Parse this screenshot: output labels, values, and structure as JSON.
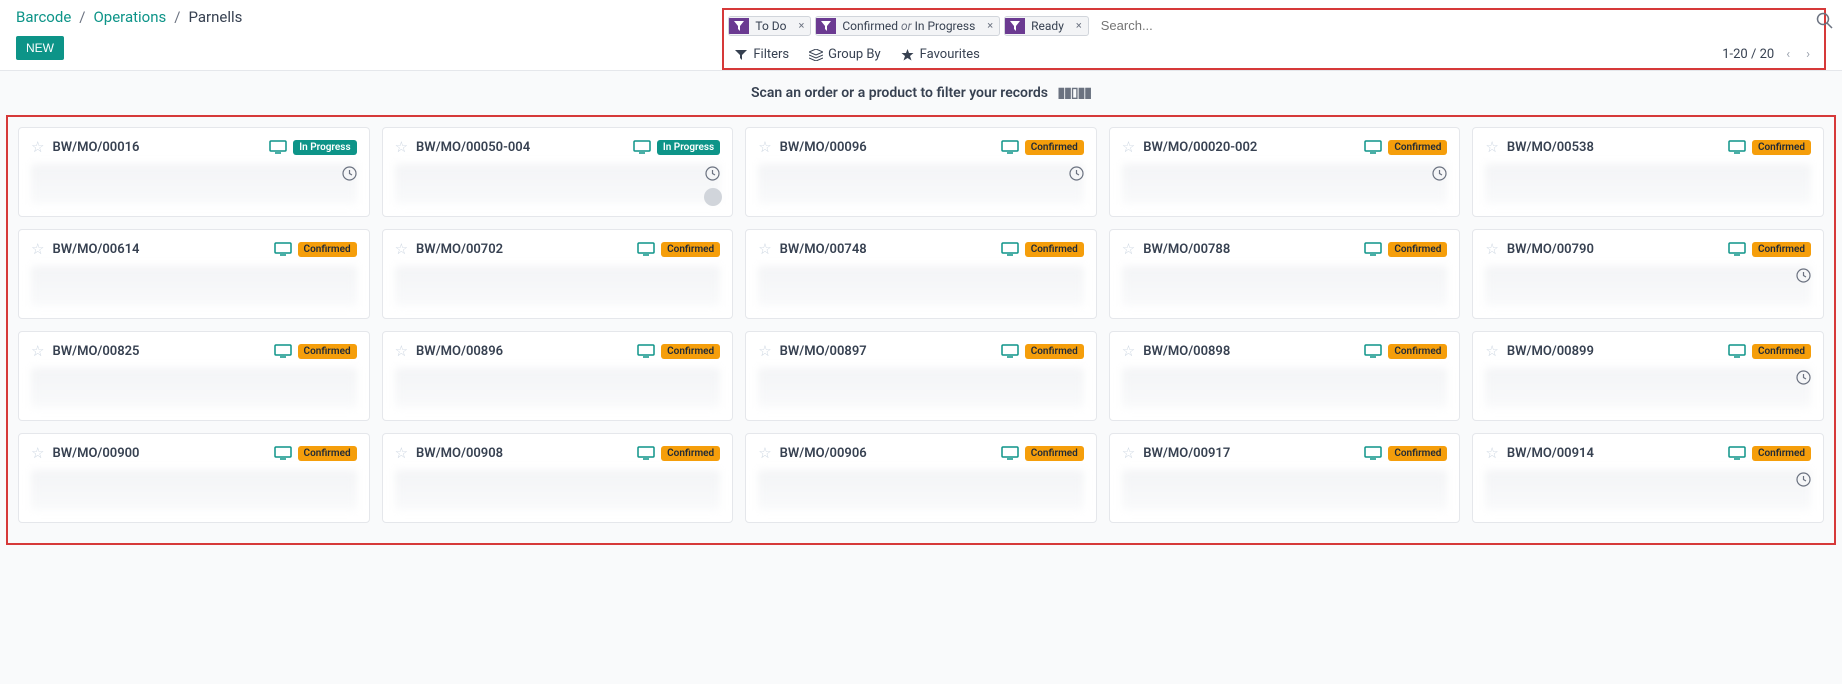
{
  "breadcrumb": {
    "root": "Barcode",
    "mid": "Operations",
    "current": "Parnells"
  },
  "buttons": {
    "new": "NEW"
  },
  "filters": {
    "facets": [
      {
        "label": "To Do"
      },
      {
        "label_html": "Confirmed <i>or</i> In Progress"
      },
      {
        "label": "Ready"
      }
    ],
    "search_placeholder": "Search..."
  },
  "toolbar": {
    "filters": "Filters",
    "groupby": "Group By",
    "favourites": "Favourites",
    "pager_range": "1-20",
    "pager_total": "20"
  },
  "status_labels": {
    "in_progress": "In Progress",
    "confirmed": "Confirmed"
  },
  "scanbar": "Scan an order or a product to filter your records",
  "cards": [
    {
      "ref": "BW/MO/00016",
      "status": "progress",
      "clock": true
    },
    {
      "ref": "BW/MO/00050-004",
      "status": "progress",
      "clock": true,
      "avatar": true
    },
    {
      "ref": "BW/MO/00096",
      "status": "confirmed",
      "clock": true
    },
    {
      "ref": "BW/MO/00020-002",
      "status": "confirmed",
      "clock": true
    },
    {
      "ref": "BW/MO/00538",
      "status": "confirmed"
    },
    {
      "ref": "BW/MO/00614",
      "status": "confirmed"
    },
    {
      "ref": "BW/MO/00702",
      "status": "confirmed"
    },
    {
      "ref": "BW/MO/00748",
      "status": "confirmed"
    },
    {
      "ref": "BW/MO/00788",
      "status": "confirmed"
    },
    {
      "ref": "BW/MO/00790",
      "status": "confirmed",
      "clock": true
    },
    {
      "ref": "BW/MO/00825",
      "status": "confirmed"
    },
    {
      "ref": "BW/MO/00896",
      "status": "confirmed"
    },
    {
      "ref": "BW/MO/00897",
      "status": "confirmed"
    },
    {
      "ref": "BW/MO/00898",
      "status": "confirmed"
    },
    {
      "ref": "BW/MO/00899",
      "status": "confirmed",
      "clock": true
    },
    {
      "ref": "BW/MO/00900",
      "status": "confirmed"
    },
    {
      "ref": "BW/MO/00908",
      "status": "confirmed"
    },
    {
      "ref": "BW/MO/00906",
      "status": "confirmed"
    },
    {
      "ref": "BW/MO/00917",
      "status": "confirmed"
    },
    {
      "ref": "BW/MO/00914",
      "status": "confirmed",
      "clock": true
    }
  ]
}
